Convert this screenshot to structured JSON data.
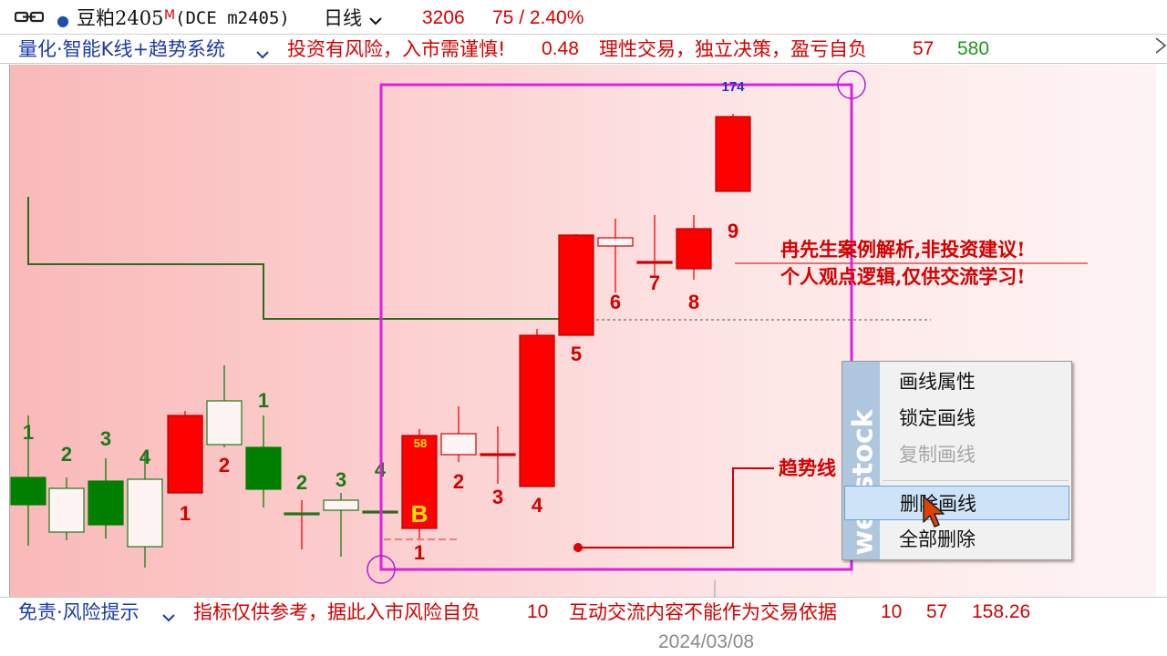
{
  "header": {
    "link_icon": "chain-link-icon",
    "status_dot": "●",
    "symbol_name": "豆粕2405",
    "symbol_flag": "M",
    "symbol_code": "(DCE m2405)",
    "period": "日线",
    "last_price": "3206",
    "change": "75 / 2.40%"
  },
  "indicator_bar": {
    "name": "量化·智能K线+趋势系统",
    "text1": "投资有风险，入市需谨慎!",
    "val1": "0.48",
    "text2": "理性交易，独立决策，盈亏自负",
    "val2": "57",
    "val3": "580"
  },
  "chart": {
    "peak_label": "174",
    "bar_value_label": "58",
    "buy_signal": "B",
    "annotation_line1": "冉先生案例解析,非投资建议!",
    "annotation_line2": "个人观点逻辑,仅供交流学习!",
    "trend_label": "趋势线",
    "candle_labels": [
      {
        "text": "1",
        "color": "#1a7a1a"
      },
      {
        "text": "2",
        "color": "#1a7a1a"
      },
      {
        "text": "3",
        "color": "#1a7a1a"
      },
      {
        "text": "4",
        "color": "#1a7a1a"
      },
      {
        "text": "1",
        "color": "#d40000"
      },
      {
        "text": "2",
        "color": "#d40000"
      },
      {
        "text": "1",
        "color": "#1a7a1a"
      },
      {
        "text": "2",
        "color": "#1a7a1a"
      },
      {
        "text": "3",
        "color": "#1a7a1a"
      },
      {
        "text": "4",
        "color": "#1a7a1a"
      },
      {
        "text": "1",
        "color": "#d40000"
      },
      {
        "text": "2",
        "color": "#d40000"
      },
      {
        "text": "3",
        "color": "#d40000"
      },
      {
        "text": "4",
        "color": "#d40000"
      },
      {
        "text": "5",
        "color": "#d40000"
      },
      {
        "text": "6",
        "color": "#d40000"
      },
      {
        "text": "7",
        "color": "#d40000"
      },
      {
        "text": "8",
        "color": "#d40000"
      },
      {
        "text": "9",
        "color": "#d40000"
      }
    ]
  },
  "context_menu": {
    "brand": "webstock",
    "items": [
      {
        "label": "画线属性",
        "state": "normal"
      },
      {
        "label": "锁定画线",
        "state": "normal"
      },
      {
        "label": "复制画线",
        "state": "disabled"
      },
      {
        "label": "删除画线",
        "state": "hover"
      },
      {
        "label": "全部删除",
        "state": "normal"
      }
    ]
  },
  "footer_bar": {
    "name": "免责·风险提示",
    "text1": "指标仅供参考，据此入市风险自负",
    "val1": "10",
    "text2": "互动交流内容不能作为交易依据",
    "val2": "10",
    "val3": "57",
    "val4": "158.26"
  },
  "x_axis": {
    "date": "2024/03/08"
  },
  "colors": {
    "up": "#ff0000",
    "down": "#008000",
    "selection": "#e020e0",
    "blue_text": "#1a3aa8",
    "red_text": "#d40000",
    "green_text": "#1a9a1a"
  }
}
